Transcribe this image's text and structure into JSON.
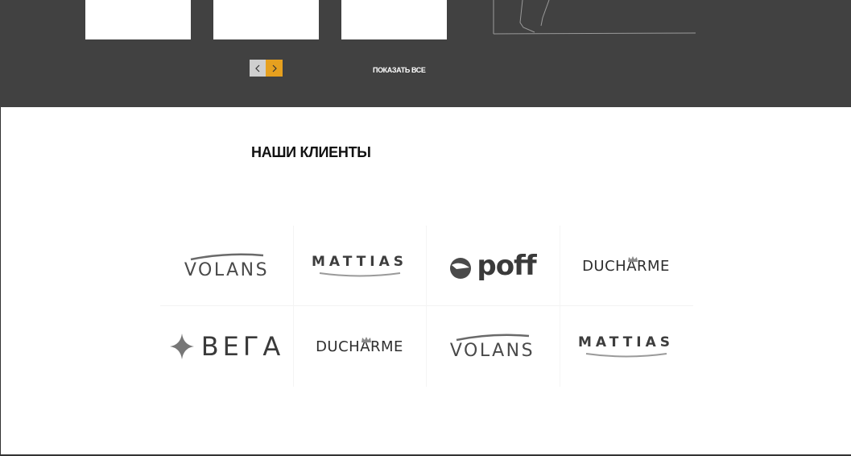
{
  "gallery": {
    "pager": {
      "prev_icon": "chevron-left-icon",
      "next_icon": "chevron-right-icon"
    },
    "show_all_label": "ПОКАЗАТЬ ВСЕ"
  },
  "clients": {
    "title": "НАШИ КЛИЕНТЫ",
    "logos": [
      {
        "name": "VOLANS"
      },
      {
        "name": "MATTIAS"
      },
      {
        "name": "poff"
      },
      {
        "name": "DUCHARME"
      },
      {
        "name": "ВЕГА"
      },
      {
        "name": "DUCHARME"
      },
      {
        "name": "VOLANS"
      },
      {
        "name": "MATTIAS"
      }
    ]
  },
  "colors": {
    "dark_band": "#414141",
    "accent": "#e6a01f",
    "pager_inactive": "#cfcfcf"
  }
}
